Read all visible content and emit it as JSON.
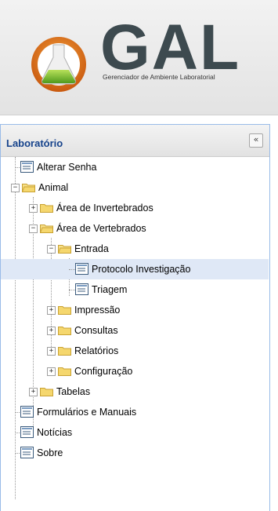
{
  "header": {
    "logo_text": "GAL",
    "subtitle": "Gerenciador de Ambiente Laboratorial"
  },
  "panel": {
    "title": "Laboratório",
    "collapse_glyph": "«"
  },
  "tree": {
    "alterar_senha": "Alterar Senha",
    "animal": "Animal",
    "invertebrados": "Área de Invertebrados",
    "vertebrados": "Área de Vertebrados",
    "entrada": "Entrada",
    "protocolo": "Protocolo Investigação",
    "triagem": "Triagem",
    "impressao": "Impressão",
    "consultas": "Consultas",
    "relatorios": "Relatórios",
    "configuracao": "Configuração",
    "tabelas": "Tabelas",
    "formularios": "Formulários e Manuais",
    "noticias": "Notícias",
    "sobre": "Sobre"
  },
  "colors": {
    "accent": "#15428b",
    "selected_row": "#dfe8f6",
    "folder": "#f5d76e",
    "logo_dark": "#3d4a4f",
    "logo_orange": "#e8761c"
  }
}
